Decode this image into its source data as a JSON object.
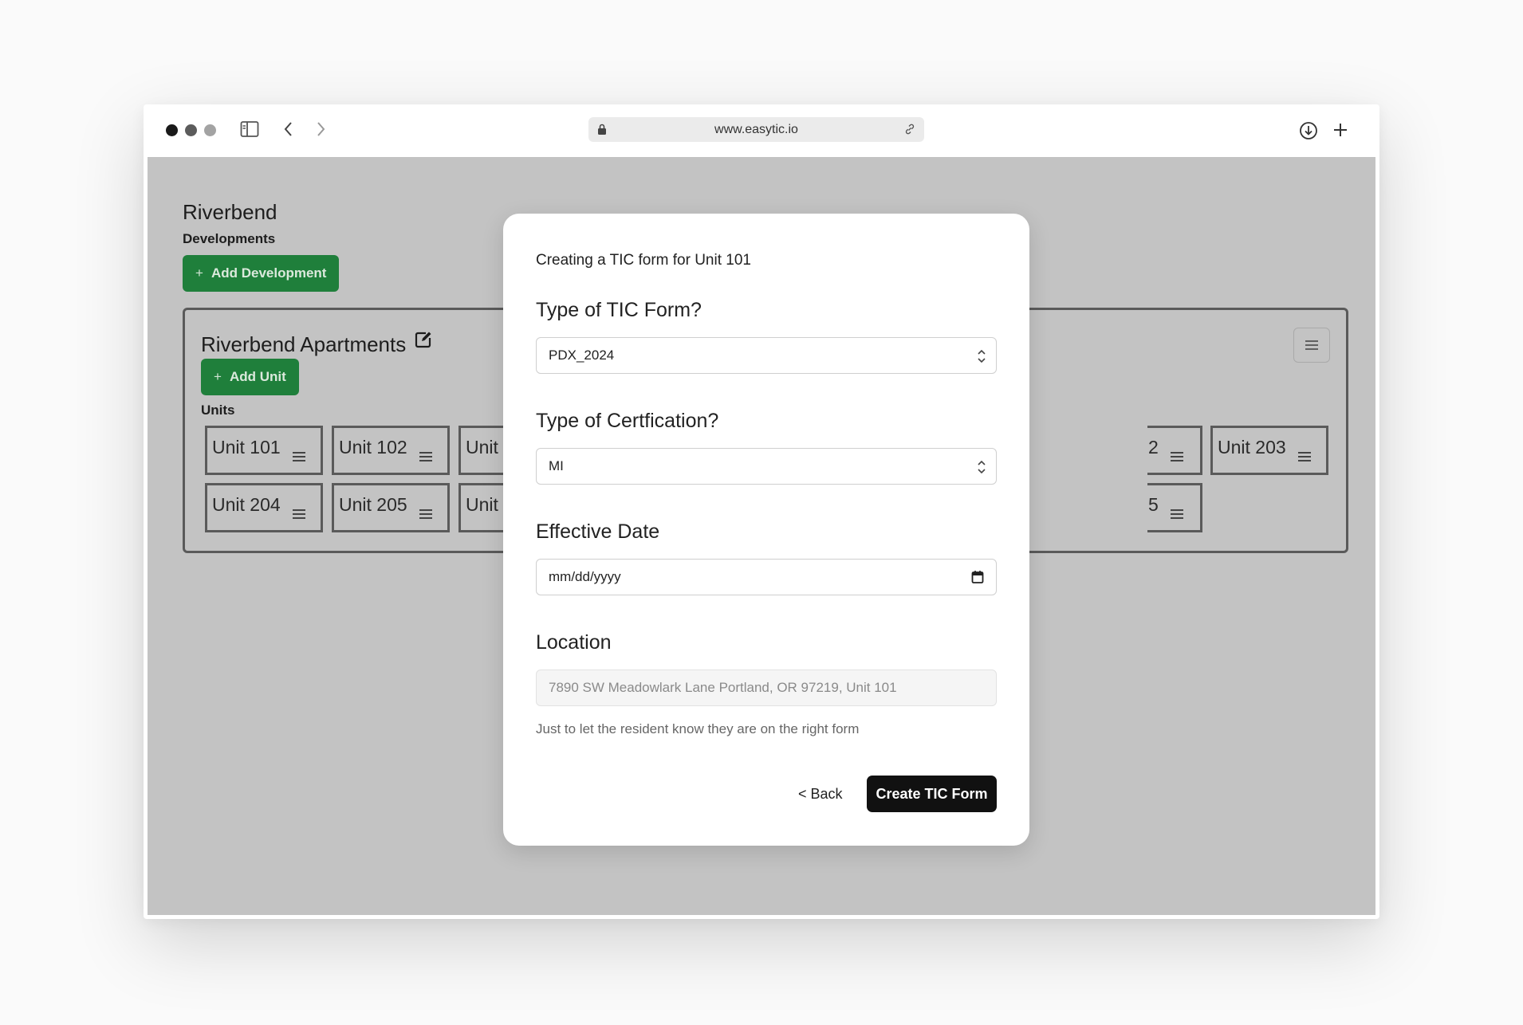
{
  "browser": {
    "url": "www.easytic.io",
    "icons": [
      "sidebar-toggle-icon",
      "back-arrow-icon",
      "forward-arrow-icon",
      "lock-icon",
      "link-icon",
      "download-icon",
      "plus-icon"
    ]
  },
  "page": {
    "title": "Riverbend",
    "developments_label": "Developments",
    "add_development_label": "Add Development",
    "development": {
      "name": "Riverbend Apartments",
      "add_unit_label": "Add Unit",
      "units_label": "Units",
      "units": [
        {
          "label": "Unit 101"
        },
        {
          "label": "Unit 102"
        },
        {
          "label": "Unit"
        },
        {
          "label": "2"
        },
        {
          "label": "Unit 203"
        },
        {
          "label": "Unit 204"
        },
        {
          "label": "Unit 205"
        },
        {
          "label": "Unit"
        },
        {
          "label": "5"
        }
      ]
    }
  },
  "modal": {
    "heading": "Creating a TIC form for Unit 101",
    "form_type_label": "Type of TIC Form?",
    "form_type_value": "PDX_2024",
    "certification_label": "Type of Certfication?",
    "certification_value": "MI",
    "effective_date_label": "Effective Date",
    "effective_date_placeholder": "mm/dd/yyyy",
    "location_label": "Location",
    "location_value": "7890 SW Meadowlark Lane Portland, OR 97219, Unit 101",
    "help_text": "Just to let the resident know they are on the right form",
    "back_label": "< Back",
    "create_label": "Create TIC Form"
  },
  "colors": {
    "overlay": "#c3c3c3",
    "green_button": "#1f7f3b",
    "primary_button": "#111111"
  }
}
